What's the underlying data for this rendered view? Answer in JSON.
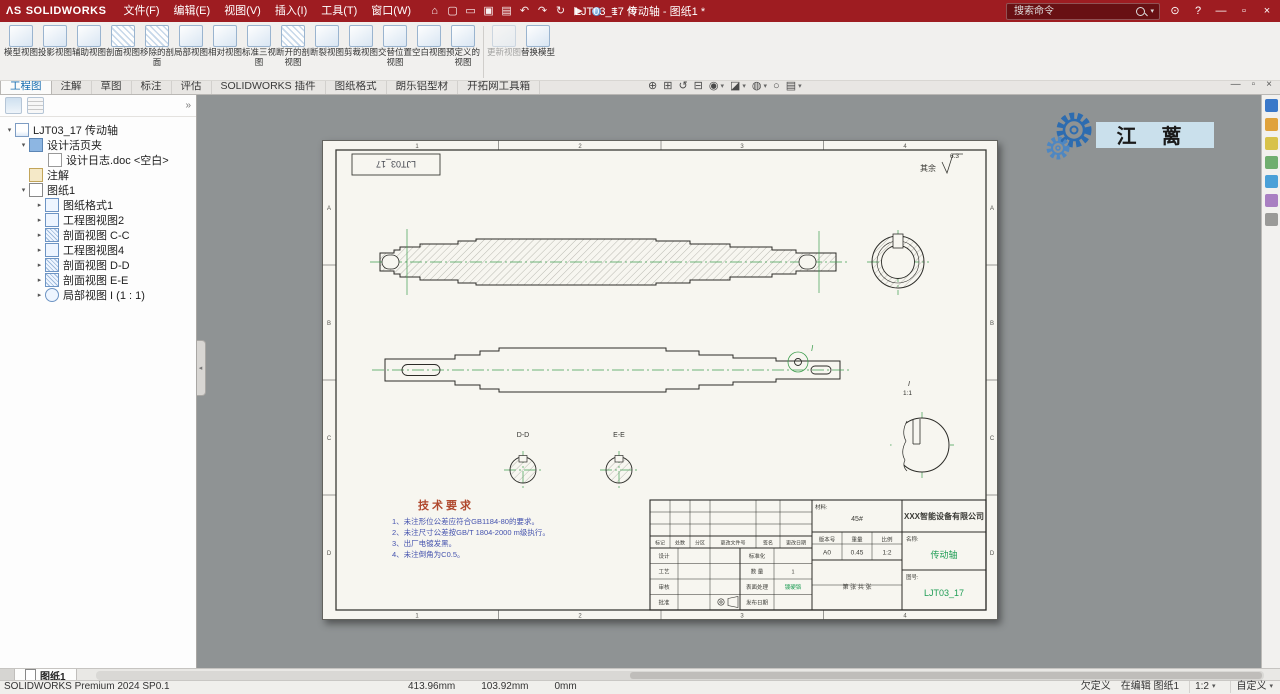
{
  "titlebar": {
    "logo_mark": "ΛS",
    "app_name": "SOLIDWORKS",
    "menus": [
      {
        "label": "文件(F)"
      },
      {
        "label": "编辑(E)"
      },
      {
        "label": "视图(V)"
      },
      {
        "label": "插入(I)"
      },
      {
        "label": "工具(T)"
      },
      {
        "label": "窗口(W)"
      }
    ],
    "doc_title": "LJT03_17 传动轴 - 图纸1 *",
    "search_placeholder": "搜索命令"
  },
  "icons": {
    "caret": "▾",
    "home": "⌂",
    "new_doc": "▢",
    "open": "▭",
    "save": "▣",
    "print": "▤",
    "undo": "↶",
    "redo": "↷",
    "rebuild": "↻",
    "select": "▶",
    "list": "≡",
    "gear": "⊛",
    "login": "⊙",
    "help": "?",
    "min": "—",
    "restore": "▫",
    "close": "×",
    "zoom_fit": "⊕",
    "zoom_area": "⊞",
    "prev_view": "↺",
    "section": "⊟",
    "orientation": "◉",
    "display_style": "◪",
    "hide_show": "◍",
    "appearance": "○",
    "view_settings": "▤",
    "panel_chevron": "»",
    "expand": "▸",
    "collapse": "▾"
  },
  "ribbon": {
    "buttons": [
      {
        "label": "模型视图"
      },
      {
        "label": "投影视图"
      },
      {
        "label": "辅助视图"
      },
      {
        "label": "剖面视图"
      },
      {
        "label": "移除的剖面"
      },
      {
        "label": "局部视图"
      },
      {
        "label": "相对视图"
      },
      {
        "label": "标准三视图"
      },
      {
        "label": "断开的剖视图"
      },
      {
        "label": "断裂视图"
      },
      {
        "label": "剪裁视图"
      },
      {
        "label": "交替位置视图"
      },
      {
        "label": "空白视图"
      },
      {
        "label": "预定义的视图"
      },
      {
        "label": "更新视图"
      },
      {
        "label": "替换模型"
      }
    ]
  },
  "tabs": {
    "items": [
      {
        "label": "工程图"
      },
      {
        "label": "注解"
      },
      {
        "label": "草图"
      },
      {
        "label": "标注"
      },
      {
        "label": "评估"
      },
      {
        "label": "SOLIDWORKS 插件"
      },
      {
        "label": "图纸格式"
      },
      {
        "label": "朗乐铝型材"
      },
      {
        "label": "开拓网工具箱"
      }
    ]
  },
  "tree": {
    "root": "LJT03_17 传动轴",
    "items": [
      {
        "label": "设计活页夹"
      },
      {
        "label": "设计日志.doc <空白>"
      },
      {
        "label": "注解"
      },
      {
        "label": "图纸1"
      },
      {
        "label": "图纸格式1"
      },
      {
        "label": "工程图视图2"
      },
      {
        "label": "剖面视图 C-C"
      },
      {
        "label": "工程图视图4"
      },
      {
        "label": "剖面视图 D-D"
      },
      {
        "label": "剖面视图 E-E"
      },
      {
        "label": "局部视图 I (1 : 1)"
      }
    ]
  },
  "logo_badge": {
    "text": "江 蓠"
  },
  "sheet": {
    "corner_code": "LJT03_17",
    "finish": {
      "prefix": "其余",
      "value": "6.3"
    },
    "zones": {
      "cols": [
        "1",
        "2",
        "3",
        "4"
      ],
      "rows": [
        "A",
        "B",
        "C",
        "D"
      ]
    },
    "section_labels": {
      "d": "D-D",
      "e": "E-E",
      "local": "I",
      "local_scale": "1:1"
    },
    "tech": {
      "title": "技术要求",
      "items": [
        "1、未注形位公差应符合GB1184-80的要求。",
        "2、未注尺寸公差按GB/T 1804-2000 m级执行。",
        "3、出厂电镀发黑。",
        "4、未注倒角为C0.5。"
      ]
    },
    "titleblock": {
      "material_label": "材料:",
      "material": "45#",
      "company": "XXX智能设备有限公司",
      "rev_headers": [
        "版本号",
        "重量",
        "比例"
      ],
      "rev_values": [
        "A0",
        "0.45",
        "1:2"
      ],
      "name_label": "名称:",
      "name": "传动轴",
      "sheet_note": "第  张  共  张",
      "no_label": "图号:",
      "no": "LJT03_17",
      "change_headers": [
        "标记",
        "处数",
        "分区",
        "更改文件号",
        "签名",
        "更改日期"
      ],
      "sign_labels": [
        "设计",
        "工艺",
        "审核",
        "批准"
      ],
      "mid_labels": [
        "标准化",
        "数 量",
        "表面处理",
        "发布日期"
      ],
      "qty_value": "1",
      "surface_value": "镀硬铬"
    }
  },
  "sheet_tab": {
    "label": "图纸1"
  },
  "statusbar": {
    "edition": "SOLIDWORKS Premium 2024 SP0.1",
    "x": "413.96mm",
    "y": "103.92mm",
    "z": "0mm",
    "state": "欠定义",
    "editing": "在编辑 图纸1",
    "scale": "1:2",
    "custom": "自定义"
  }
}
